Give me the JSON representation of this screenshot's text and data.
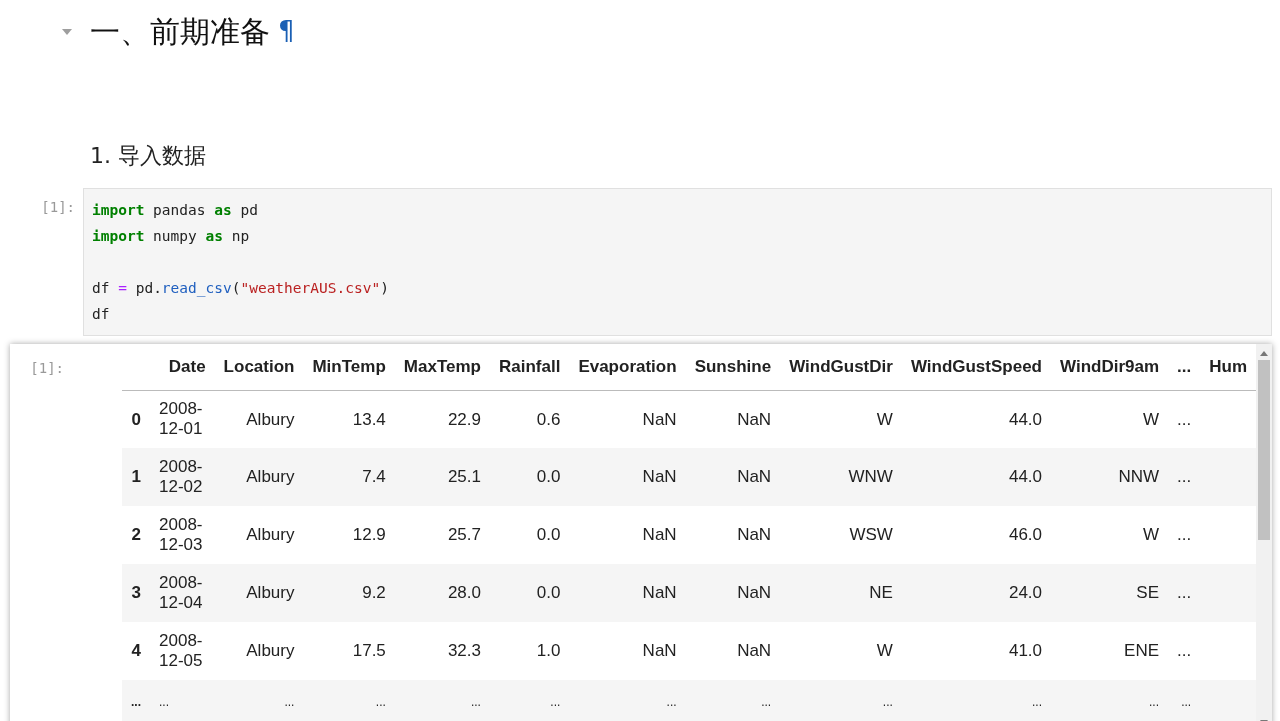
{
  "heading": {
    "text": "一、前期准备",
    "anchor": "¶",
    "expanded": true
  },
  "subheading": "1. 导入数据",
  "code_cell": {
    "prompt": "[1]:",
    "lines": [
      {
        "tokens": [
          {
            "kind": "keyword",
            "text": "import"
          },
          {
            "kind": "plain",
            "text": " pandas "
          },
          {
            "kind": "keyword",
            "text": "as"
          },
          {
            "kind": "plain",
            "text": " pd"
          }
        ]
      },
      {
        "tokens": [
          {
            "kind": "keyword",
            "text": "import"
          },
          {
            "kind": "plain",
            "text": " numpy "
          },
          {
            "kind": "keyword",
            "text": "as"
          },
          {
            "kind": "plain",
            "text": " np"
          }
        ]
      },
      {
        "blank_line_before": true,
        "tokens": [
          {
            "kind": "plain",
            "text": "df "
          },
          {
            "kind": "operator",
            "text": "="
          },
          {
            "kind": "plain",
            "text": " pd."
          },
          {
            "kind": "function",
            "text": "read_csv"
          },
          {
            "kind": "plain",
            "text": "("
          },
          {
            "kind": "string",
            "text": "\"weatherAUS.csv\""
          },
          {
            "kind": "plain",
            "text": ")"
          }
        ]
      },
      {
        "tokens": [
          {
            "kind": "plain",
            "text": "df"
          }
        ]
      }
    ]
  },
  "output": {
    "prompt": "[1]:",
    "table": {
      "columns": [
        "Date",
        "Location",
        "MinTemp",
        "MaxTemp",
        "Rainfall",
        "Evaporation",
        "Sunshine",
        "WindGustDir",
        "WindGustSpeed",
        "WindDir9am",
        "...",
        "Hum"
      ],
      "rows": [
        {
          "index": "0",
          "cells": [
            "2008-12-01",
            "Albury",
            "13.4",
            "22.9",
            "0.6",
            "NaN",
            "NaN",
            "W",
            "44.0",
            "W",
            "...",
            ""
          ]
        },
        {
          "index": "1",
          "cells": [
            "2008-12-02",
            "Albury",
            "7.4",
            "25.1",
            "0.0",
            "NaN",
            "NaN",
            "WNW",
            "44.0",
            "NNW",
            "...",
            ""
          ]
        },
        {
          "index": "2",
          "cells": [
            "2008-12-03",
            "Albury",
            "12.9",
            "25.7",
            "0.0",
            "NaN",
            "NaN",
            "WSW",
            "46.0",
            "W",
            "...",
            ""
          ]
        },
        {
          "index": "3",
          "cells": [
            "2008-12-04",
            "Albury",
            "9.2",
            "28.0",
            "0.0",
            "NaN",
            "NaN",
            "NE",
            "24.0",
            "SE",
            "...",
            ""
          ]
        },
        {
          "index": "4",
          "cells": [
            "2008-12-05",
            "Albury",
            "17.5",
            "32.3",
            "1.0",
            "NaN",
            "NaN",
            "W",
            "41.0",
            "ENE",
            "...",
            ""
          ]
        },
        {
          "index": "...",
          "cells": [
            "...",
            "...",
            "...",
            "...",
            "...",
            "...",
            "...",
            "...",
            "...",
            "...",
            "...",
            ""
          ]
        }
      ]
    }
  }
}
